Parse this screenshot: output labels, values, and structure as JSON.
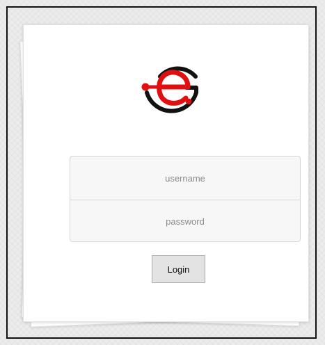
{
  "login_form": {
    "username_placeholder": "username",
    "password_placeholder": "password",
    "login_label": "Login"
  },
  "logo": {
    "icon": "eg-logo-icon",
    "primary_color": "#e01010",
    "secondary_color": "#111111"
  }
}
